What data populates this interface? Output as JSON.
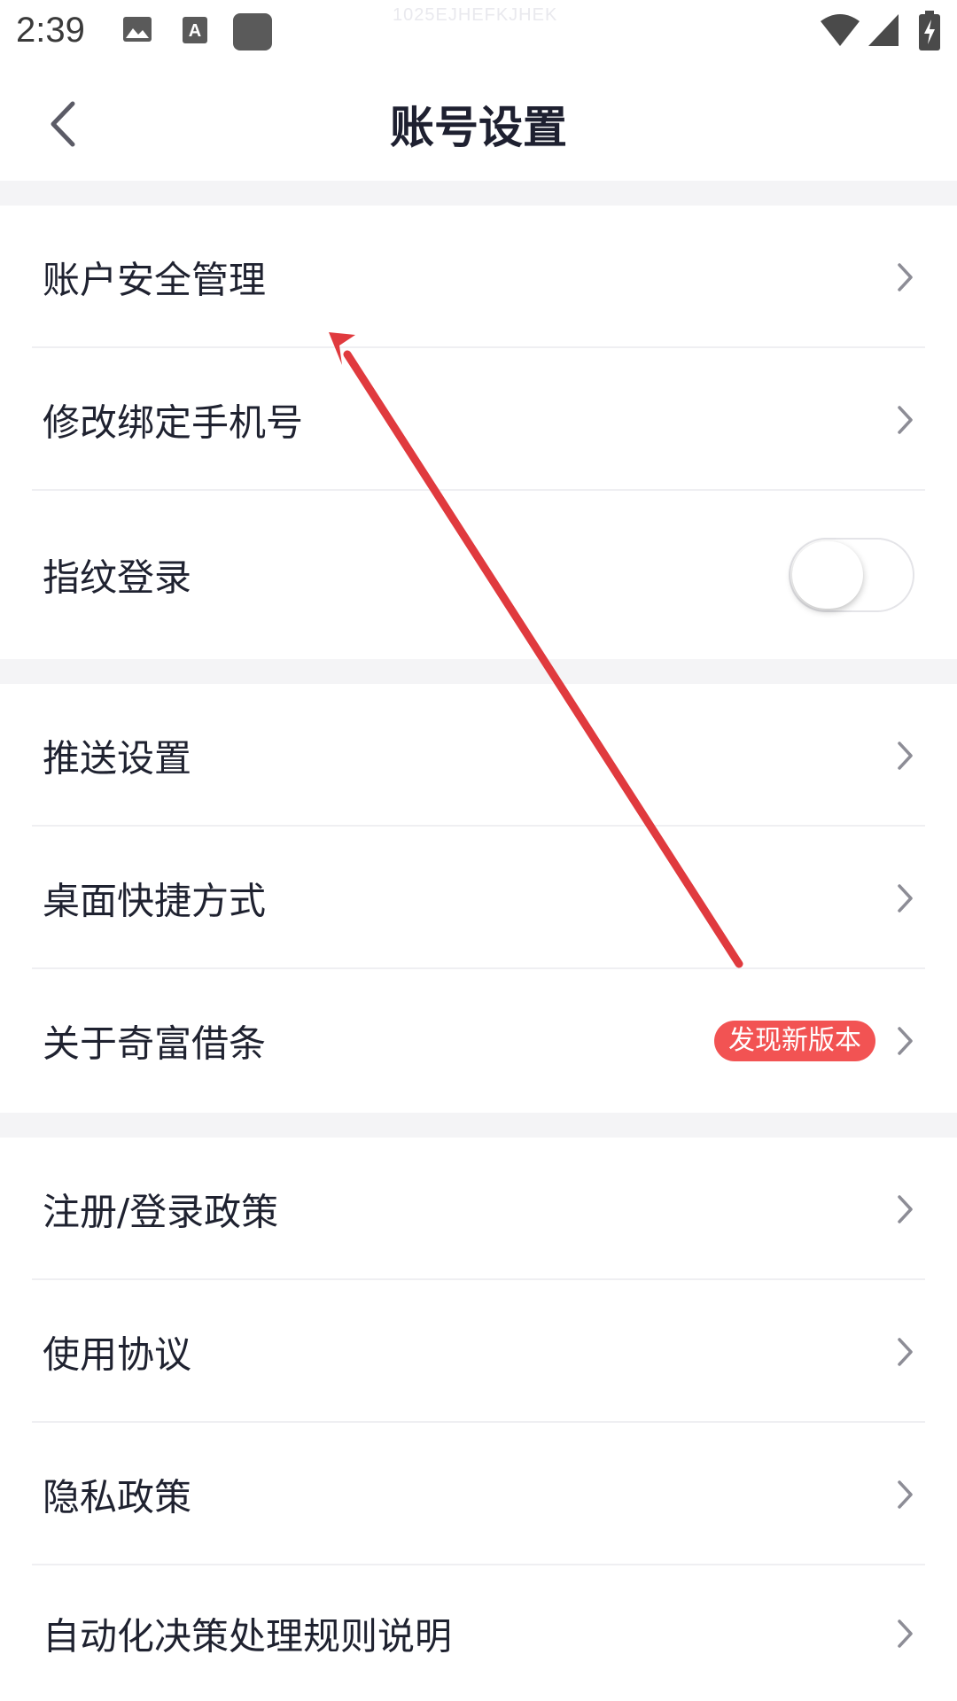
{
  "status_bar": {
    "time": "2:39",
    "watermark": "1025EJHEFKJHEK",
    "icons": [
      "image-icon",
      "a-notification-icon",
      "app-square-icon",
      "wifi-icon",
      "signal-icon",
      "battery-charging-icon"
    ]
  },
  "header": {
    "title": "账号设置",
    "back_icon": "chevron-left-icon"
  },
  "groups": {
    "security": {
      "account_security": "账户安全管理",
      "change_phone": "修改绑定手机号",
      "fingerprint_login": "指纹登录",
      "fingerprint_enabled": false
    },
    "app": {
      "push_settings": "推送设置",
      "desktop_shortcut": "桌面快捷方式",
      "about": "关于奇富借条",
      "about_badge": "发现新版本"
    },
    "legal": {
      "register_policy": "注册/登录政策",
      "user_agreement": "使用协议",
      "privacy_policy": "隐私政策",
      "automated_decision_rules": "自动化决策处理规则说明"
    }
  },
  "colors": {
    "badge": "#f25353",
    "annotation_arrow": "#e03a3e",
    "section_gap": "#f4f4f6"
  }
}
